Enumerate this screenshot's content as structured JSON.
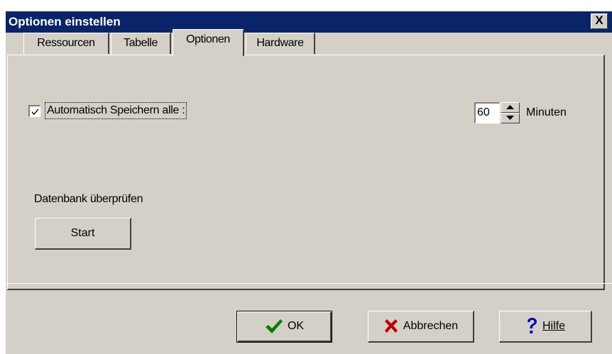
{
  "window": {
    "title": "Optionen einstellen",
    "close_label": "X"
  },
  "tabs": [
    {
      "label": "Ressourcen",
      "active": false
    },
    {
      "label": "Tabelle",
      "active": false
    },
    {
      "label": "Optionen",
      "active": true
    },
    {
      "label": "Hardware",
      "active": false
    }
  ],
  "options": {
    "autosave_label": "Automatisch Speichern alle :",
    "autosave_checked": true,
    "autosave_value": "60",
    "autosave_unit": "Minuten",
    "db_check_label": "Datenbank überprüfen",
    "start_label": "Start"
  },
  "buttons": {
    "ok_label": "OK",
    "cancel_label": "Abbrechen",
    "help_label": "Hilfe"
  },
  "icons": {
    "ok": "checkmark-icon",
    "cancel": "x-mark-icon",
    "help": "question-mark-icon"
  },
  "colors": {
    "titlebar": "#0a246a",
    "face": "#d4d0c8",
    "ok_icon": "#008000",
    "cancel_icon": "#c00000",
    "help_icon": "#0000c0"
  }
}
